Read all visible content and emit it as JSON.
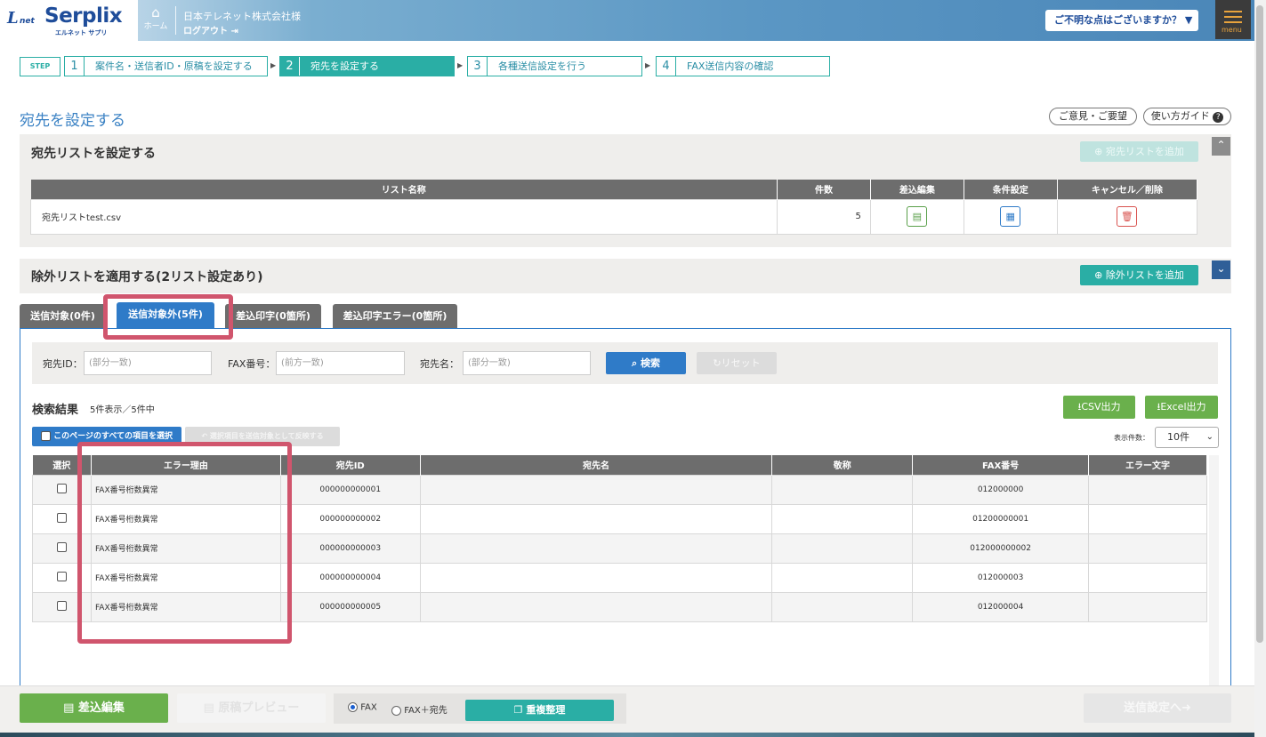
{
  "header": {
    "logo_l": "L",
    "logo_net": "net",
    "logo_text": "Serplix",
    "logo_sub": "エルネット サプリ",
    "home_label": "ホーム",
    "company": "日本テレネット株式会社様",
    "logout": "ログアウト",
    "help": "ご不明な点はございますか？ ▼",
    "menu": "menu"
  },
  "steps": {
    "label": "STEP",
    "items": [
      {
        "num": "1",
        "label": "案件名・送信者ID・原稿を設定する"
      },
      {
        "num": "2",
        "label": "宛先を設定する"
      },
      {
        "num": "3",
        "label": "各種送信設定を行う"
      },
      {
        "num": "4",
        "label": "FAX送信内容の確認"
      }
    ]
  },
  "page": {
    "title": "宛先を設定する",
    "feedback": "ご意見・ご要望",
    "guide": "使い方ガイド"
  },
  "dest_section": {
    "title": "宛先リストを設定する",
    "add_button": "宛先リストを追加",
    "columns": [
      "リスト名称",
      "件数",
      "差込編集",
      "条件設定",
      "キャンセル／削除"
    ],
    "rows": [
      {
        "name": "宛先リストtest.csv",
        "count": "5"
      }
    ]
  },
  "exclude_section": {
    "title": "除外リストを適用する(2リスト設定あり)",
    "add_button": "除外リストを追加"
  },
  "tabs": [
    "送信対象(0件)",
    "送信対象外(5件)",
    "差込印字(0箇所)",
    "差込印字エラー(0箇所)"
  ],
  "search": {
    "id_label": "宛先ID：",
    "id_placeholder": "(部分一致)",
    "fax_label": "FAX番号：",
    "fax_placeholder": "(前方一致)",
    "name_label": "宛先名：",
    "name_placeholder": "(部分一致)",
    "search_button": "検索",
    "reset_button": "リセット"
  },
  "results": {
    "title": "検索結果",
    "count": "5件表示／5件中",
    "csv_button": "CSV出力",
    "excel_button": "Excel出力",
    "select_all": "このページのすべての項目を選択",
    "restore": "選択項目を送信対象として反映する",
    "per_page_label": "表示件数：",
    "per_page_value": "10件",
    "columns": [
      "選択",
      "エラー理由",
      "宛先ID",
      "宛先名",
      "敬称",
      "FAX番号",
      "エラー文字"
    ],
    "rows": [
      {
        "reason": "FAX番号桁数異常",
        "id": "000000000001",
        "name": "",
        "honorific": "",
        "fax": "012000000",
        "error_char": ""
      },
      {
        "reason": "FAX番号桁数異常",
        "id": "000000000002",
        "name": "",
        "honorific": "",
        "fax": "01200000001",
        "error_char": ""
      },
      {
        "reason": "FAX番号桁数異常",
        "id": "000000000003",
        "name": "",
        "honorific": "",
        "fax": "012000000002",
        "error_char": ""
      },
      {
        "reason": "FAX番号桁数異常",
        "id": "000000000004",
        "name": "",
        "honorific": "",
        "fax": "012000003",
        "error_char": ""
      },
      {
        "reason": "FAX番号桁数異常",
        "id": "000000000005",
        "name": "",
        "honorific": "",
        "fax": "012000004",
        "error_char": ""
      }
    ]
  },
  "bottom": {
    "merge_edit": "差込編集",
    "preview": "原稿プレビュー",
    "radio_fax": "FAX",
    "radio_fax_dest": "FAX＋宛先",
    "dedupe": "重複整理",
    "next": "送信設定へ"
  },
  "colors": {
    "teal": "#2aaea5",
    "blue": "#2f7bc8",
    "green": "#6ab04c",
    "highlight": "#d0556d"
  }
}
